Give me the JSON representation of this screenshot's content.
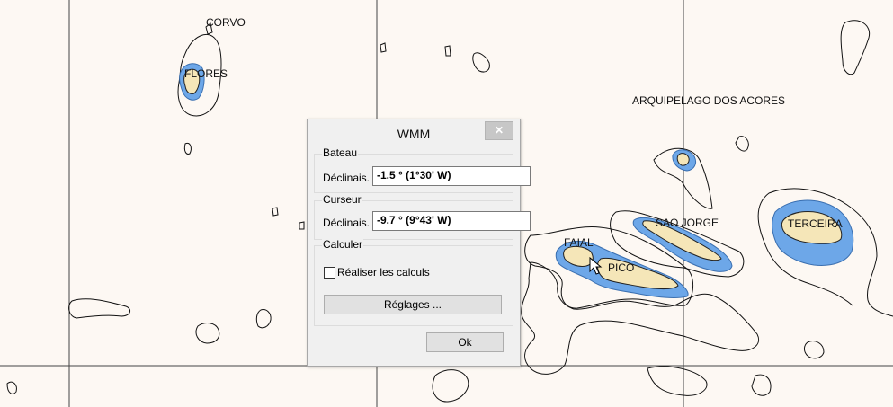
{
  "map": {
    "colors": {
      "background": "#fdf8f3",
      "land": "#f5e6b8",
      "shallow_water": "#6da7e8",
      "contour": "#000000",
      "grid": "#444444"
    },
    "labels": {
      "corvo": "CORVO",
      "flores": "FLORES",
      "archipelago": "ARQUIPELAGO DOS ACORES",
      "sao_jorge": "SAO JORGE",
      "terceira": "TERCEIRA",
      "faial": "FAIAL",
      "pico": "PICO"
    }
  },
  "dialog": {
    "title": "WMM",
    "close_label": "✕",
    "bateau": {
      "group_label": "Bateau",
      "field_label": "Déclinais.",
      "value": "-1.5 ° (1°30' W)"
    },
    "curseur": {
      "group_label": "Curseur",
      "field_label": "Déclinais.",
      "value": "-9.7 ° (9°43' W)"
    },
    "calculer": {
      "group_label": "Calculer",
      "checkbox_label": "Réaliser les calculs",
      "checked": false,
      "settings_button": "Réglages ..."
    },
    "ok_button": "Ok"
  }
}
